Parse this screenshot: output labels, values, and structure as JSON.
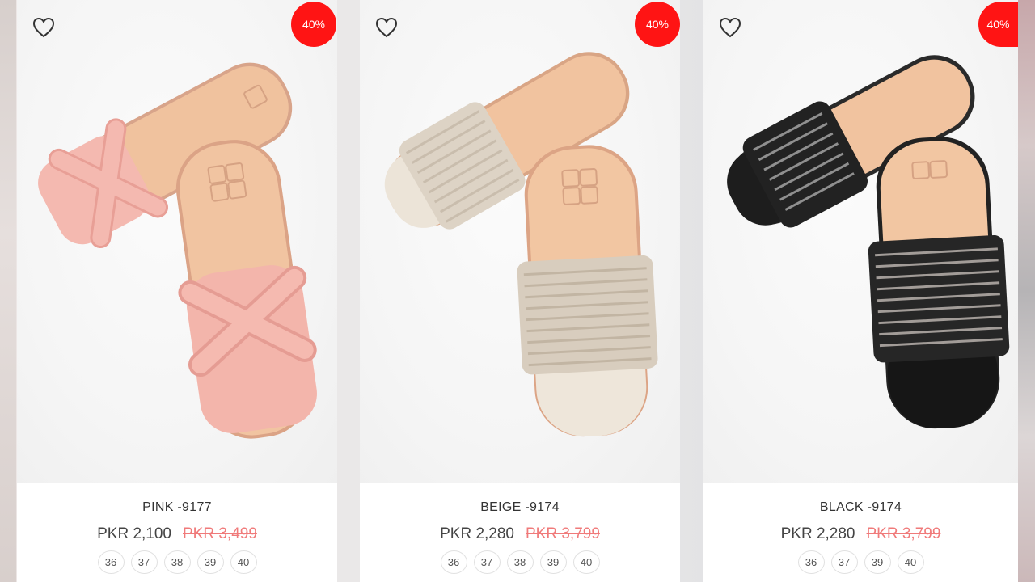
{
  "products": [
    {
      "name": "PINK -9177",
      "price": "PKR 2,100",
      "old_price": "PKR 3,499",
      "discount": "40%",
      "color": "#f2b8ad",
      "sizes": [
        "36",
        "37",
        "38",
        "39",
        "40"
      ]
    },
    {
      "name": "BEIGE -9174",
      "price": "PKR 2,280",
      "old_price": "PKR 3,799",
      "discount": "40%",
      "color": "#e4ddd2",
      "sizes": [
        "36",
        "37",
        "38",
        "39",
        "40"
      ]
    },
    {
      "name": "BLACK -9174",
      "price": "PKR 2,280",
      "old_price": "PKR 3,799",
      "discount": "40%",
      "color": "#1f1f1f",
      "sizes": [
        "36",
        "37",
        "39",
        "40"
      ]
    }
  ],
  "icons": {
    "wishlist": "heart-outline-icon"
  },
  "colors": {
    "badge": "#ff1414",
    "old_price": "#f07a7a",
    "sole": "#efc3a0"
  }
}
